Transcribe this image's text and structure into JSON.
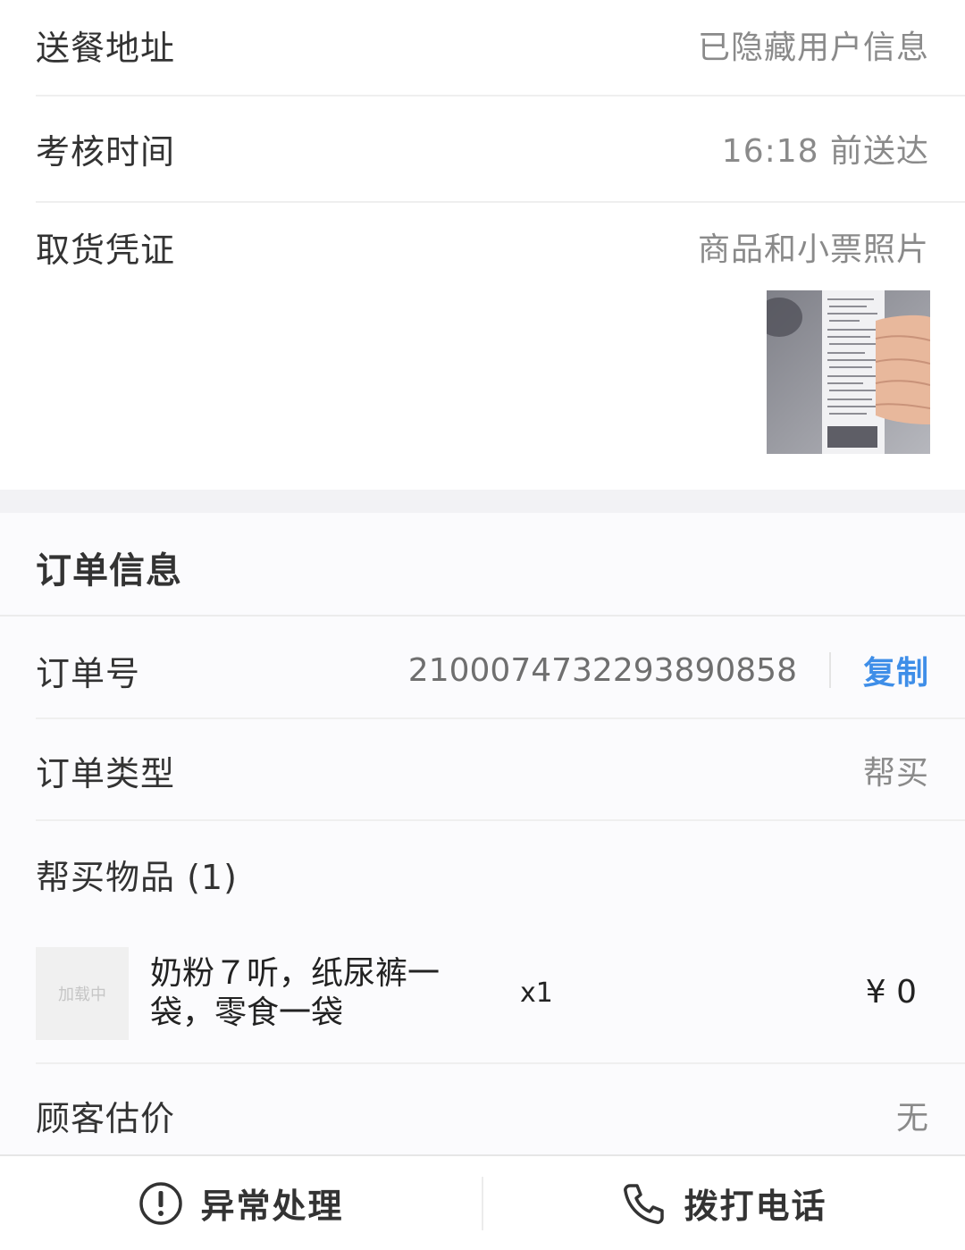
{
  "delivery": {
    "address_label": "送餐地址",
    "address_value": "已隐藏用户信息",
    "check_time_label": "考核时间",
    "check_time_value": "16:18 前送达",
    "pickup_proof_label": "取货凭证",
    "pickup_proof_value": "商品和小票照片",
    "pickup_proof_image": "receipt-photo"
  },
  "order": {
    "section_title": "订单信息",
    "number_label": "订单号",
    "number_value": "2100074732293890858",
    "copy_label": "复制",
    "type_label": "订单类型",
    "type_value": "帮买",
    "items_label": "帮买物品 (1)",
    "items": [
      {
        "thumb_text": "加载中",
        "name": "奶粉７听，纸尿裤一袋，零食一袋",
        "qty": "x1",
        "price": "¥ 0"
      }
    ],
    "estimate_label": "顾客估价",
    "estimate_value": "无"
  },
  "bottom_bar": {
    "exception_label": "异常处理",
    "exception_icon": "exclamation-circle-icon",
    "call_label": "拨打电话",
    "call_icon": "phone-icon"
  },
  "colors": {
    "accent": "#3e8ee8",
    "text": "#333333",
    "muted": "#8a8a8a"
  }
}
